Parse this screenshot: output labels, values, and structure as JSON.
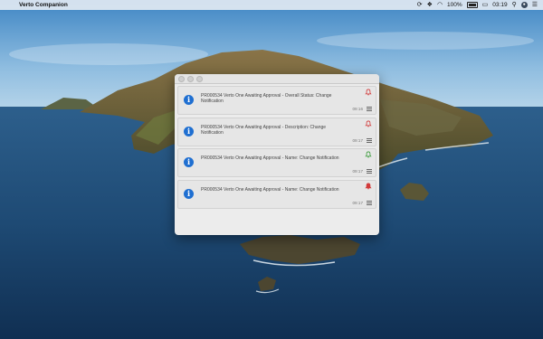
{
  "menubar": {
    "app_name": "Verto Companion",
    "battery_percent": "100%",
    "clock": "03:19"
  },
  "colors": {
    "info_icon": "#1f6fd1",
    "bell_red": "#d23b3b",
    "bell_green": "#3a9b3a"
  },
  "notifications": [
    {
      "text": "PR000534 Verto One Awaiting Approval - Overall Status: Change Notification",
      "time": "09:16",
      "bell": "bell-red-icon"
    },
    {
      "text": "PR000534 Verto One Awaiting Approval - Description: Change Notification",
      "time": "09:17",
      "bell": "bell-red-icon"
    },
    {
      "text": "PR000534 Verto One Awaiting Approval - Name: Change Notification",
      "time": "09:17",
      "bell": "bell-green-icon"
    },
    {
      "text": "PR000534 Verto One Awaiting Approval - Name: Change Notification",
      "time": "09:17",
      "bell": "bell-red-icon"
    }
  ]
}
